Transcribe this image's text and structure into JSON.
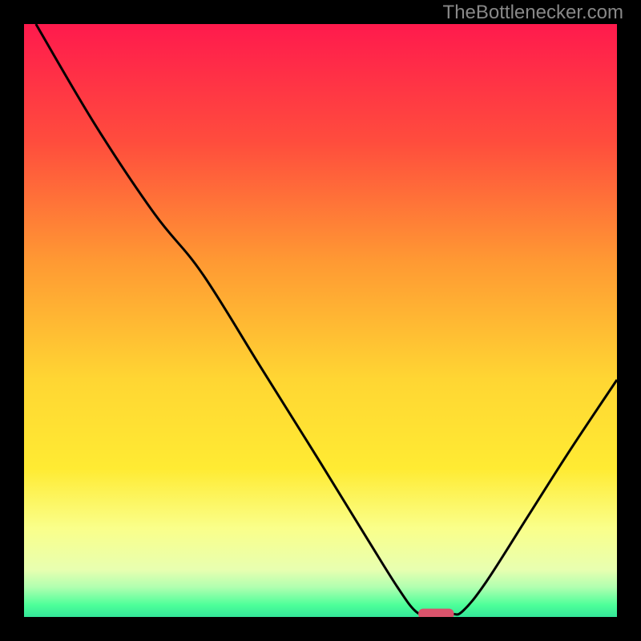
{
  "watermark": "TheBottlenecker.com",
  "chart_data": {
    "type": "line",
    "title": "",
    "xlabel": "",
    "ylabel": "",
    "xlim": [
      0,
      100
    ],
    "ylim": [
      0,
      100
    ],
    "background_gradient": {
      "stops": [
        {
          "offset": 0,
          "color": "#ff1a4d"
        },
        {
          "offset": 20,
          "color": "#ff4d3d"
        },
        {
          "offset": 40,
          "color": "#ff9933"
        },
        {
          "offset": 60,
          "color": "#ffd633"
        },
        {
          "offset": 75,
          "color": "#ffeb33"
        },
        {
          "offset": 85,
          "color": "#faff8a"
        },
        {
          "offset": 92,
          "color": "#e8ffb0"
        },
        {
          "offset": 95,
          "color": "#b0ffb0"
        },
        {
          "offset": 98,
          "color": "#4dff99"
        },
        {
          "offset": 100,
          "color": "#33e699"
        }
      ]
    },
    "curve": {
      "description": "V-shaped bottleneck curve",
      "points": [
        {
          "x": 2,
          "y": 100
        },
        {
          "x": 12,
          "y": 83
        },
        {
          "x": 22,
          "y": 68
        },
        {
          "x": 30,
          "y": 58
        },
        {
          "x": 40,
          "y": 42
        },
        {
          "x": 50,
          "y": 26
        },
        {
          "x": 58,
          "y": 13
        },
        {
          "x": 63,
          "y": 5
        },
        {
          "x": 66,
          "y": 1
        },
        {
          "x": 68,
          "y": 0.5
        },
        {
          "x": 72,
          "y": 0.5
        },
        {
          "x": 74,
          "y": 1
        },
        {
          "x": 78,
          "y": 6
        },
        {
          "x": 85,
          "y": 17
        },
        {
          "x": 92,
          "y": 28
        },
        {
          "x": 100,
          "y": 40
        }
      ]
    },
    "marker": {
      "x": 69.5,
      "y": 0.5,
      "width": 6,
      "height": 1.8,
      "color": "#d9536b"
    }
  }
}
